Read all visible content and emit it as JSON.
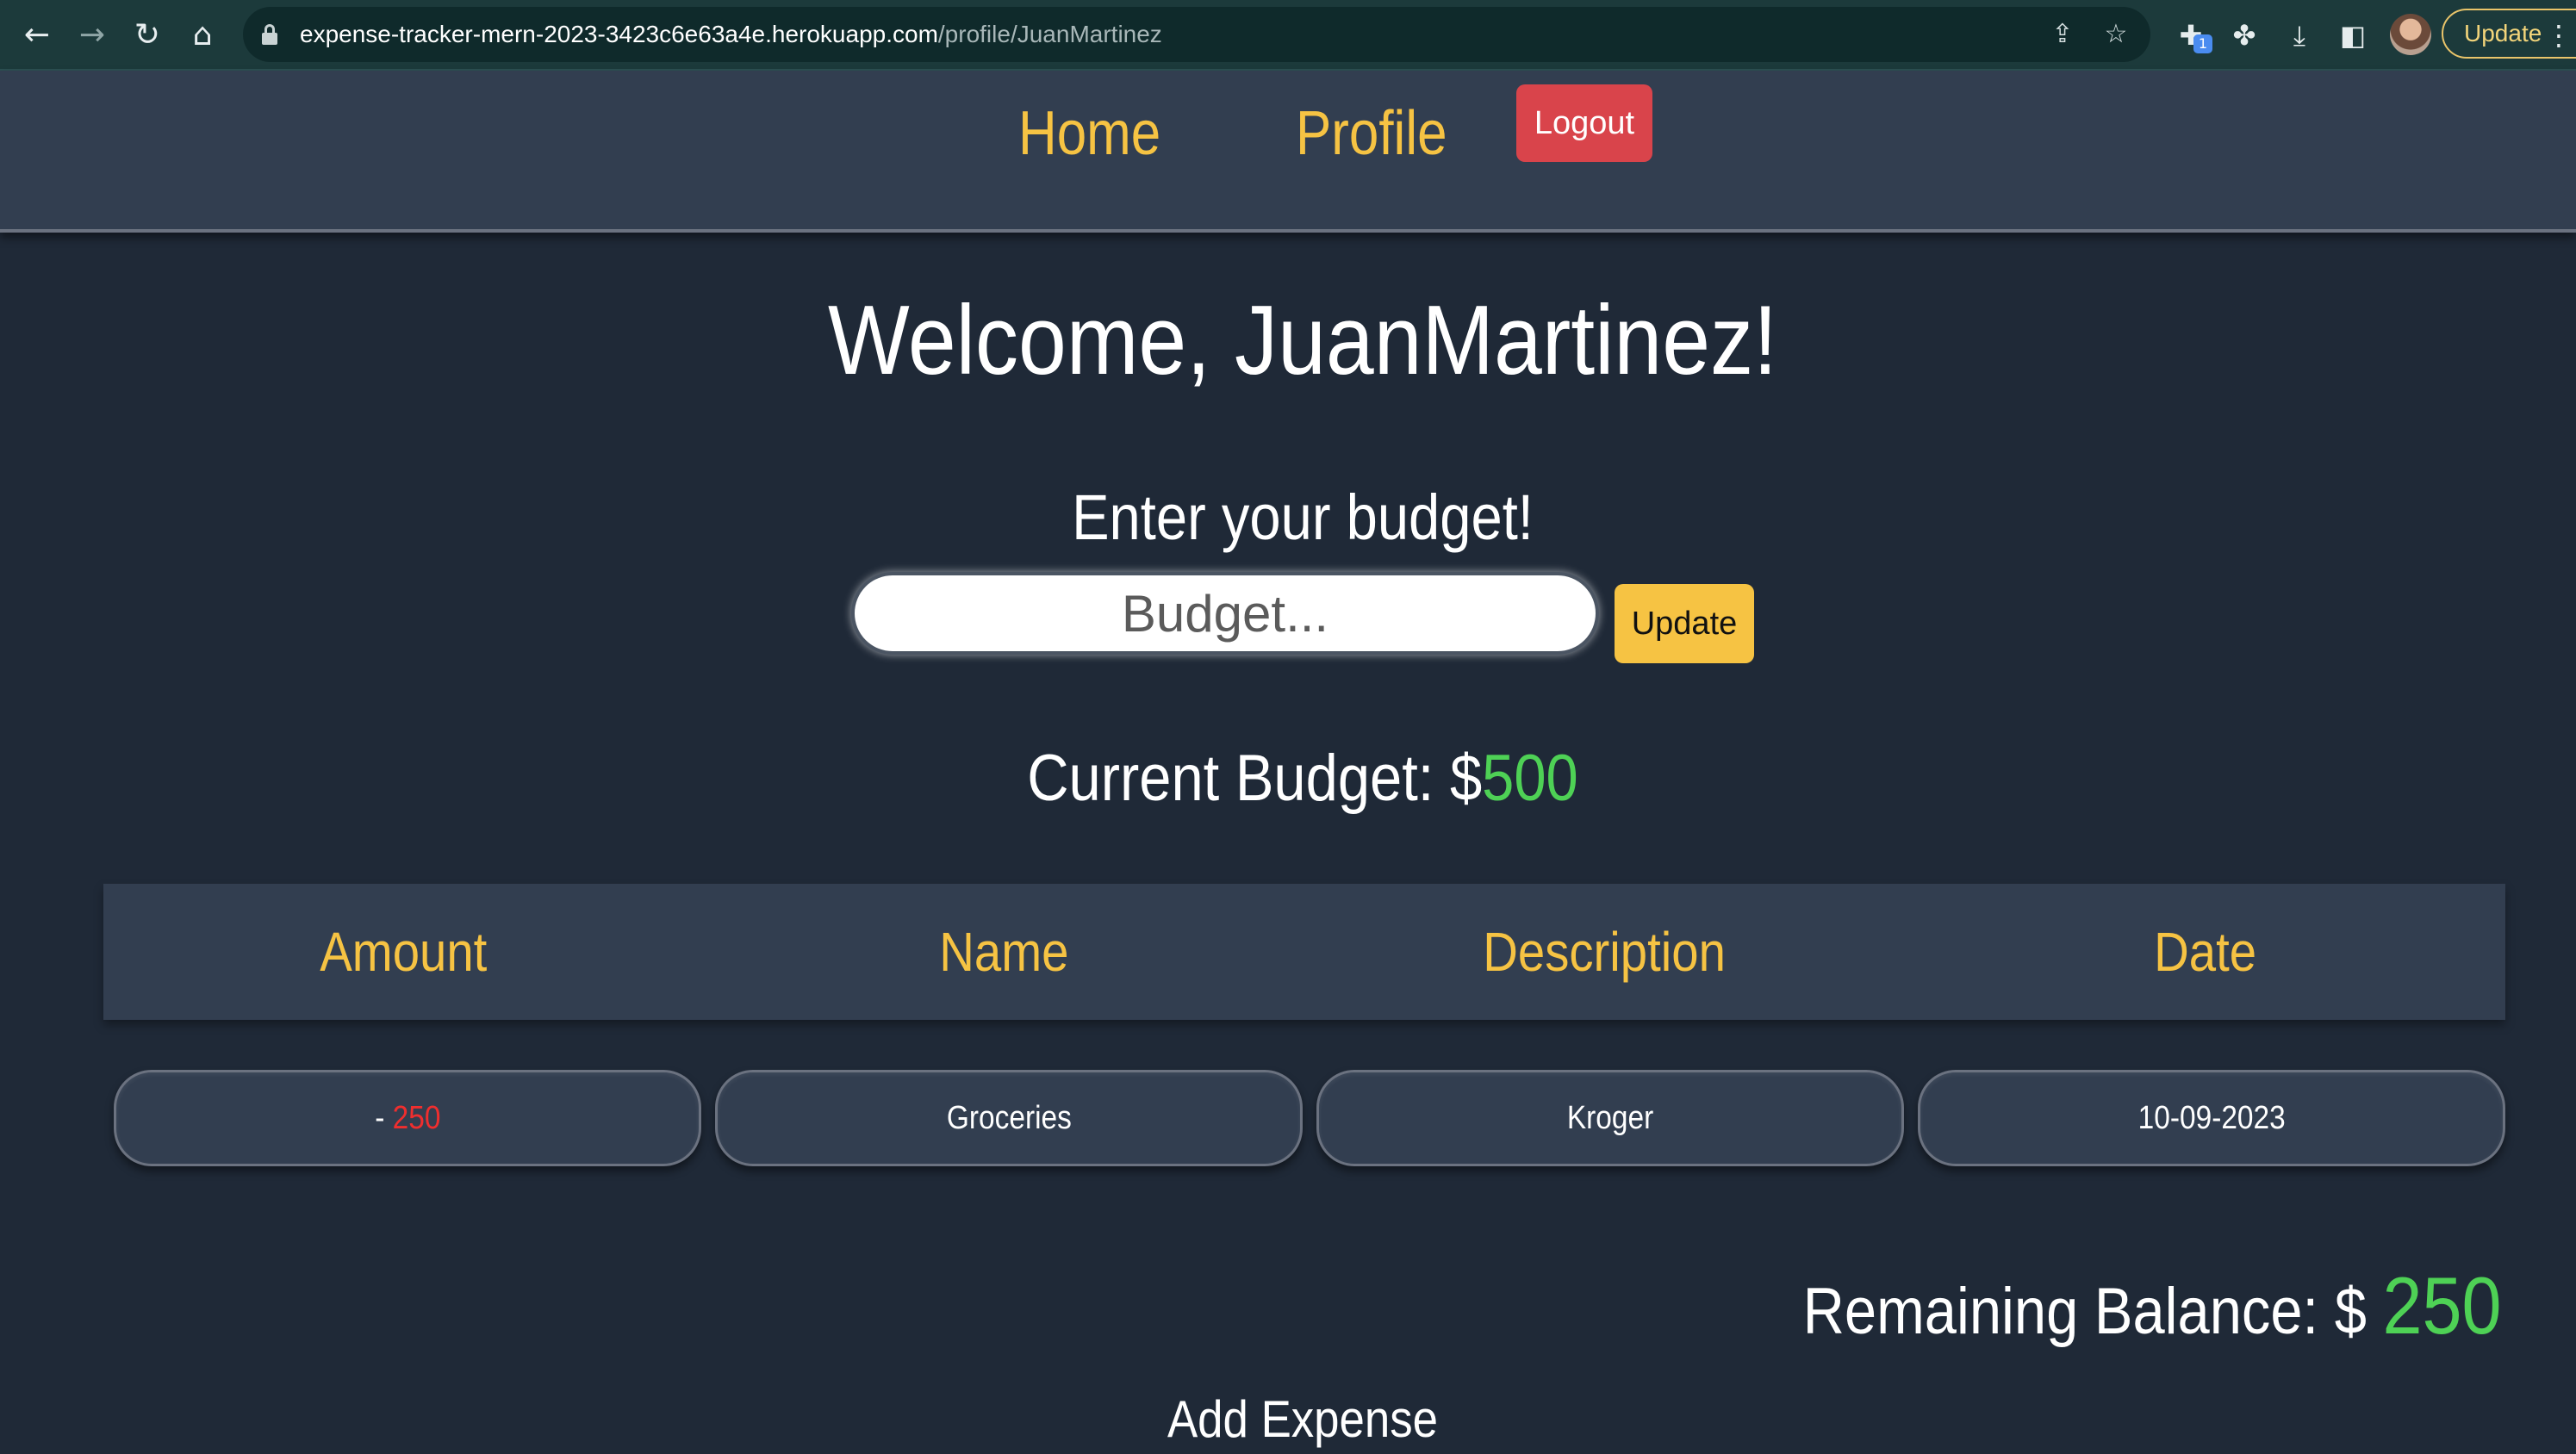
{
  "browser": {
    "url_host": "expense-tracker-mern-2023-3423c6e63a4e.herokuapp.com",
    "url_path": "/profile/JuanMartinez",
    "update_label": "Update",
    "extension_badge": "1",
    "icons": [
      "back-icon",
      "forward-icon",
      "reload-icon",
      "home-icon",
      "lock-icon",
      "share-icon",
      "star-icon",
      "extension-icon",
      "puzzle-icon",
      "download-icon",
      "sidepanel-icon",
      "avatar",
      "more-icon"
    ]
  },
  "nav": {
    "home": "Home",
    "profile": "Profile",
    "logout": "Logout"
  },
  "main": {
    "welcome": "Welcome, JuanMartinez!",
    "budget_prompt": "Enter your budget!",
    "budget_placeholder": "Budget...",
    "update_button": "Update",
    "current_budget_label": "Current Budget: $",
    "current_budget_value": "500"
  },
  "table": {
    "headers": [
      "Amount",
      "Name",
      "Description",
      "Date"
    ],
    "rows": [
      {
        "amount_prefix": "- ",
        "amount": "250",
        "name": "Groceries",
        "description": "Kroger",
        "date": "10-09-2023"
      }
    ]
  },
  "summary": {
    "remaining_label": "Remaining Balance: $ ",
    "remaining_value": "250",
    "add_expense": "Add Expense"
  },
  "colors": {
    "background": "#1f2937",
    "panel": "#323e50",
    "accent_yellow": "#f6c343",
    "logout_red": "#d9444b",
    "positive_green": "#4ed155",
    "negative_red": "#ef2e2e"
  }
}
